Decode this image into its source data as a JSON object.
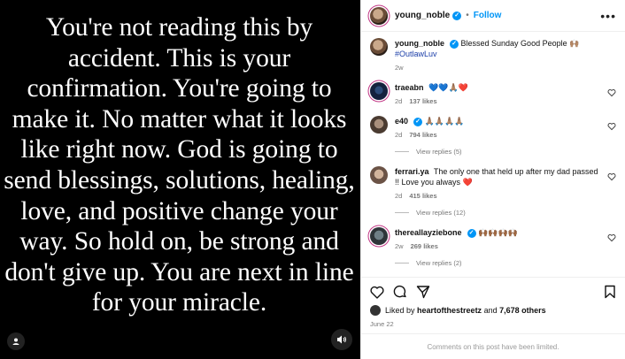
{
  "media": {
    "quote": "You're not reading this by\naccident. This is your\nconfirmation. You're going to\nmake it. No matter what it looks\nlike right now. God is going to\nsend blessings, solutions, healing,\nlove, and positive change your\nway. So hold on, be strong and\ndon't give up. You are next in line\nfor your miracle."
  },
  "header": {
    "username": "young_noble",
    "separator": "•",
    "follow_label": "Follow",
    "more_label": "•••"
  },
  "caption": {
    "username": "young_noble",
    "text": "Blessed Sunday Good People 🙌🏽",
    "hashtag": "#OutlawLuv",
    "age": "2w"
  },
  "comments": [
    {
      "username": "traeabn",
      "text": "💙💙🙏🏽❤️",
      "age": "2d",
      "likes": "137 likes",
      "verified": false,
      "replies": ""
    },
    {
      "username": "e40",
      "text": "🙏🏽🙏🏽🙏🏽🙏🏽",
      "age": "2d",
      "likes": "794 likes",
      "verified": true,
      "replies": "View replies (5)"
    },
    {
      "username": "ferrari.ya",
      "text": "The only one that held up after my dad passed !! Love you always ❤️",
      "age": "2d",
      "likes": "415 likes",
      "verified": false,
      "replies": "View replies (12)"
    },
    {
      "username": "thereallayziebone",
      "text": "🙌🏾🙌🏾🙌🏾🙌🏾",
      "age": "2w",
      "likes": "269 likes",
      "verified": true,
      "replies": "View replies (2)"
    }
  ],
  "likes": {
    "prefix": "Liked by",
    "by_user": "heartofthestreetz",
    "and": "and",
    "others": "7,678 others"
  },
  "date": "June 22",
  "limited_notice": "Comments on this post have been limited.",
  "colors": {
    "accent": "#0095f6",
    "media_bg": "#000000",
    "hashtag": "#1b3ea8",
    "liked_heart": "#ed4956"
  },
  "icons": [
    "user-tag-icon",
    "mute-icon",
    "heart-icon",
    "comment-icon",
    "share-icon",
    "bookmark-icon",
    "more-icon",
    "verified-icon"
  ]
}
